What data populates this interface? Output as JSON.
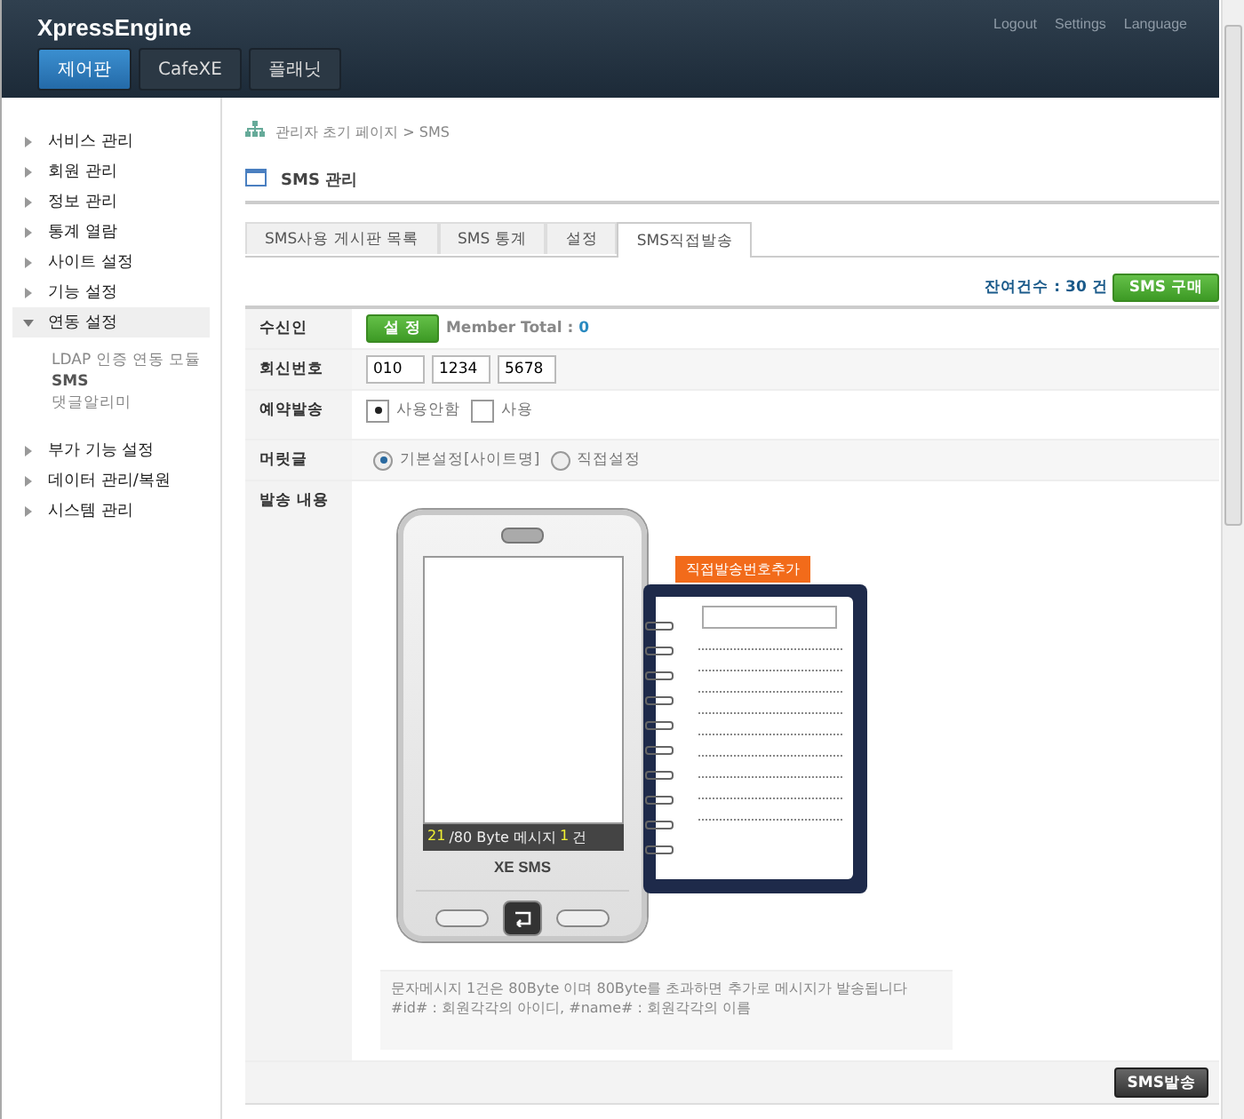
{
  "header": {
    "brand": "XpressEngine",
    "links": [
      "Logout",
      "Settings",
      "Language"
    ],
    "nav": [
      {
        "label": "제어판",
        "selected": true
      },
      {
        "label": "CafeXE",
        "selected": false
      },
      {
        "label": "플래닛",
        "selected": false
      }
    ]
  },
  "sidebar": {
    "items": [
      {
        "label": "서비스 관리",
        "expanded": false
      },
      {
        "label": "회원 관리",
        "expanded": false
      },
      {
        "label": "정보 관리",
        "expanded": false
      },
      {
        "label": "통계 열람",
        "expanded": false
      },
      {
        "label": "사이트 설정",
        "expanded": false
      },
      {
        "label": "기능 설정",
        "expanded": false
      },
      {
        "label": "연동 설정",
        "expanded": true,
        "children": [
          {
            "label": "LDAP 인증 연동 모듈",
            "selected": false
          },
          {
            "label": "SMS",
            "selected": true
          },
          {
            "label": "댓글알리미",
            "selected": false
          }
        ]
      },
      {
        "label": "부가 기능 설정",
        "expanded": false
      },
      {
        "label": "데이터 관리/복원",
        "expanded": false
      },
      {
        "label": "시스템 관리",
        "expanded": false
      }
    ]
  },
  "breadcrumb": "관리자 초기 페이지 > SMS",
  "section_title": "SMS 관리",
  "tabs": [
    {
      "label": "SMS사용 게시판 목록",
      "selected": false
    },
    {
      "label": "SMS 통계",
      "selected": false
    },
    {
      "label": "설정",
      "selected": false
    },
    {
      "label": "SMS직접발송",
      "selected": true
    }
  ],
  "balance": "잔여건수 : 30 건",
  "buy_button": "SMS 구매",
  "form": [
    {
      "kind": "recipient",
      "label": "수신인",
      "button": "설 정",
      "total_label": "Member Total :",
      "total": "0"
    },
    {
      "kind": "phone",
      "label": "회신번호",
      "values": [
        "010",
        "1234",
        "5678"
      ]
    },
    {
      "kind": "boxradio",
      "label": "예약발송",
      "options": [
        {
          "label": "사용안함",
          "selected": true
        },
        {
          "label": "사용",
          "selected": false
        }
      ]
    },
    {
      "kind": "radio",
      "label": "머릿글",
      "options": [
        {
          "label": "기본설정[사이트명]",
          "selected": true
        },
        {
          "label": "직접설정",
          "selected": false
        }
      ]
    },
    {
      "kind": "message",
      "label": "발송 내용"
    }
  ],
  "phone": {
    "count": "21",
    "limit": "/80 Byte 메시지",
    "messages": "1",
    "unit": "건",
    "brand": "XE SMS"
  },
  "add_number_button": "직접발송번호추가",
  "notes": [
    "문자메시지 1건은 80Byte 이며 80Byte를 초과하면 추가로 메시지가 발송됩니다",
    "#id# : 회원각각의 아이디, #name# : 회원각각의 이름"
  ],
  "send_button": "SMS발송"
}
